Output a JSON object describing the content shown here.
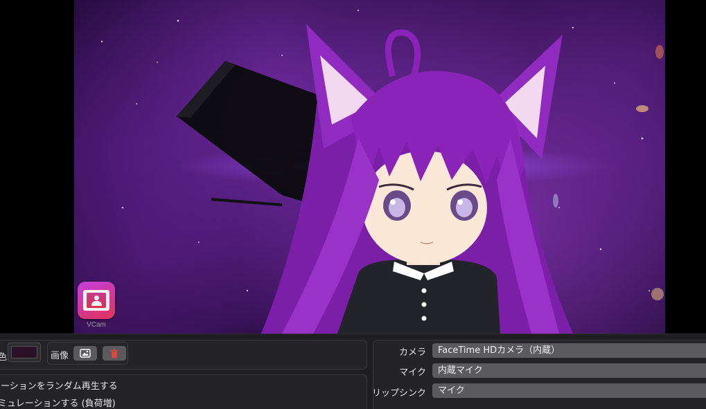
{
  "preview": {
    "badge_label": "VCam"
  },
  "background_group": {
    "color_label": "色",
    "color_value": "#2a1126",
    "image_label": "画像"
  },
  "options": {
    "random_motion": "モーションをランダム再生する",
    "physics": "シミュレーションする (負荷増)"
  },
  "devices": {
    "camera_label": "カメラ",
    "camera_value": "FaceTime HDカメラ（内蔵）",
    "mic_label": "マイク",
    "mic_value": "内蔵マイク",
    "lipsync_label": "リップシンク",
    "lipsync_value": "マイク"
  },
  "icons": [
    "vcam-app-icon",
    "image-icon",
    "trash-icon"
  ],
  "colors": {
    "accent_badge": "#c23fd9",
    "delete_icon": "#e0463a",
    "panel_bg": "#1e1e20",
    "select_bg": "#5b5b5f"
  }
}
